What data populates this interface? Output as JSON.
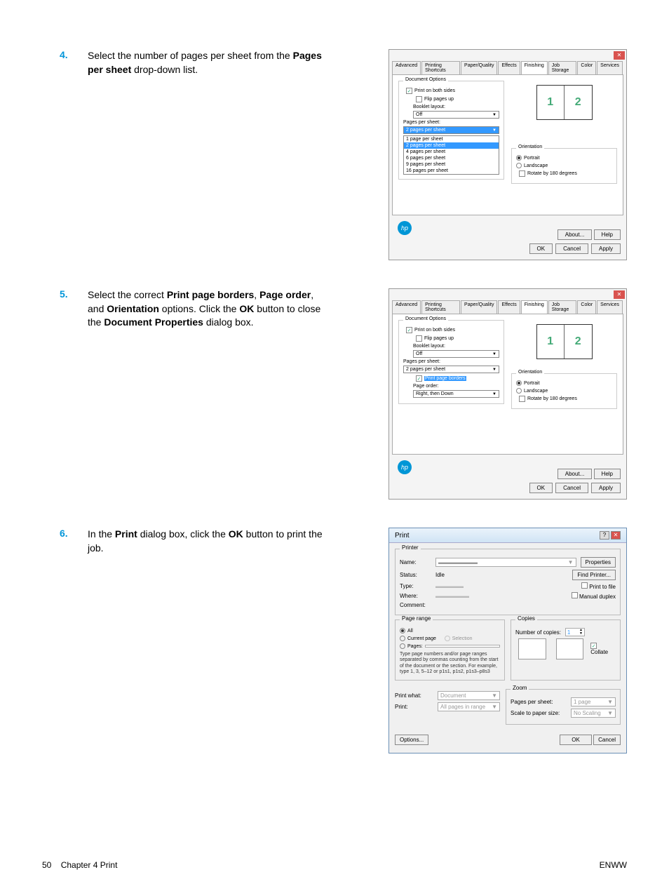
{
  "steps": [
    {
      "num": "4.",
      "text_pre": "Select the number of pages per sheet from the ",
      "b1": "Pages per sheet",
      "text_post": " drop-down list."
    },
    {
      "num": "5.",
      "text_pre": "Select the correct ",
      "b1": "Print page borders",
      "sep1": ", ",
      "b2": "Page order",
      "sep2": ", and ",
      "b3": "Orientation",
      "mid": " options. Click the ",
      "b4": "OK",
      "post": " button to close the ",
      "b5": "Document Properties",
      "end": " dialog box."
    },
    {
      "num": "6.",
      "text_pre": "In the ",
      "b1": "Print",
      "mid": " dialog box, click the ",
      "b2": "OK",
      "post": " button to print the job."
    }
  ],
  "dialog1": {
    "tabs": [
      "Advanced",
      "Printing Shortcuts",
      "Paper/Quality",
      "Effects",
      "Finishing",
      "Job Storage",
      "Color",
      "Services"
    ],
    "doc_options": "Document Options",
    "print_both": "Print on both sides",
    "flip": "Flip pages up",
    "booklet": "Booklet layout:",
    "off": "Off",
    "pps_label": "Pages per sheet:",
    "pps_value": "2 pages per sheet",
    "pps_options": [
      "1 page per sheet",
      "2 pages per sheet",
      "4 pages per sheet",
      "6 pages per sheet",
      "9 pages per sheet",
      "16 pages per sheet"
    ],
    "orientation": "Orientation",
    "portrait": "Portrait",
    "landscape": "Landscape",
    "rotate": "Rotate by 180 degrees",
    "about": "About...",
    "help": "Help",
    "ok": "OK",
    "cancel": "Cancel",
    "apply": "Apply",
    "preview1": "1",
    "preview2": "2"
  },
  "dialog2": {
    "pps_value": "2 pages per sheet",
    "borders": "Print page borders",
    "page_order": "Page order:",
    "page_order_val": "Right, then Down"
  },
  "print": {
    "title": "Print",
    "printer": "Printer",
    "name": "Name:",
    "status": "Status:",
    "status_val": "Idle",
    "type": "Type:",
    "where": "Where:",
    "comment": "Comment:",
    "properties": "Properties",
    "find": "Find Printer...",
    "to_file": "Print to file",
    "manual": "Manual duplex",
    "page_range": "Page range",
    "all": "All",
    "current": "Current page",
    "selection": "Selection",
    "pages": "Pages:",
    "hint": "Type page numbers and/or page ranges separated by commas counting from the start of the document or the section. For example, type 1, 3, 5–12 or p1s1, p1s2, p1s3–p8s3",
    "copies": "Copies",
    "num_copies": "Number of copies:",
    "copies_val": "1",
    "collate": "Collate",
    "print_what": "Print what:",
    "print_what_val": "Document",
    "print_label": "Print:",
    "print_val": "All pages in range",
    "zoom": "Zoom",
    "pps": "Pages per sheet:",
    "pps_val": "1 page",
    "scale": "Scale to paper size:",
    "scale_val": "No Scaling",
    "options": "Options...",
    "ok": "OK",
    "cancel": "Cancel"
  },
  "footer": {
    "left_num": "50",
    "left_text": "Chapter 4   Print",
    "right": "ENWW"
  }
}
